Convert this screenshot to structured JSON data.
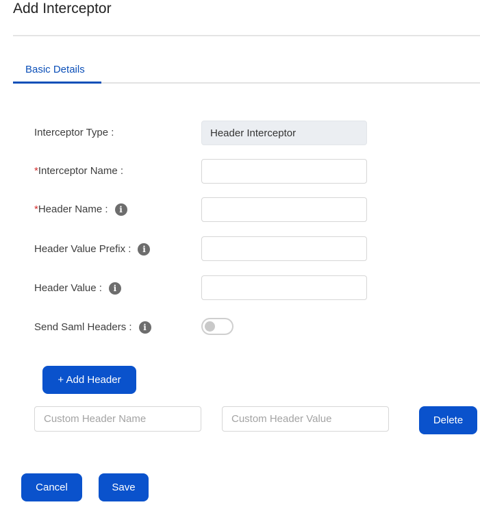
{
  "page": {
    "title": "Add Interceptor"
  },
  "tabs": [
    {
      "label": "Basic Details",
      "active": true
    }
  ],
  "form": {
    "interceptor_type": {
      "label": "Interceptor Type :",
      "value": "Header Interceptor"
    },
    "interceptor_name": {
      "required_mark": "*",
      "label": "Interceptor Name :",
      "value": ""
    },
    "header_name": {
      "required_mark": "*",
      "label": "Header Name :",
      "value": "",
      "info_icon": "info-icon"
    },
    "header_value_prefix": {
      "label": "Header Value Prefix :",
      "value": "",
      "info_icon": "info-icon"
    },
    "header_value": {
      "label": "Header Value :",
      "value": "",
      "info_icon": "info-icon"
    },
    "send_saml_headers": {
      "label": "Send Saml Headers :",
      "enabled": false,
      "info_icon": "info-icon"
    }
  },
  "custom_headers": {
    "add_button_label": "+ Add Header",
    "rows": [
      {
        "name_placeholder": "Custom Header Name",
        "value_placeholder": "Custom Header Value",
        "delete_label": "Delete"
      }
    ]
  },
  "actions": {
    "cancel_label": "Cancel",
    "save_label": "Save"
  },
  "colors": {
    "primary": "#0a52cc",
    "tab_active": "#0b4fb8",
    "required": "#d32f2f"
  }
}
